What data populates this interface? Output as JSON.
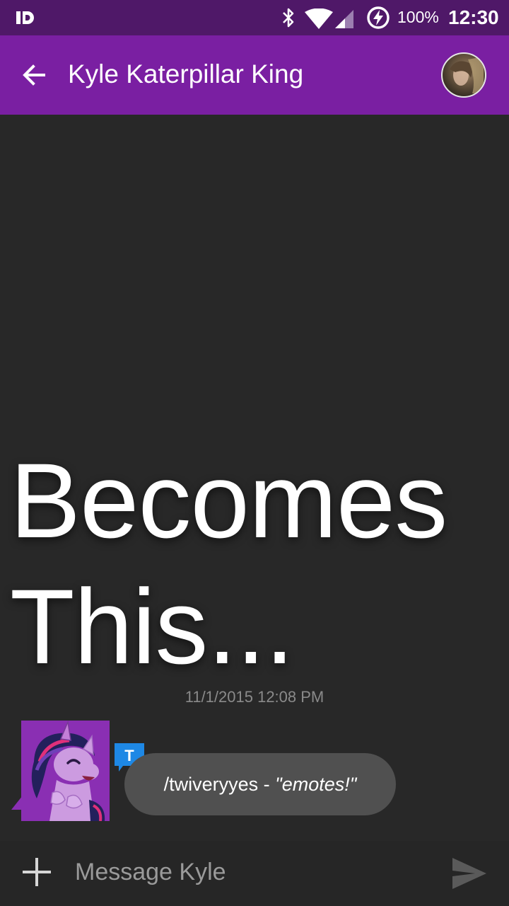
{
  "status_bar": {
    "left_icon": "id-app-icon",
    "icons": [
      "bluetooth-icon",
      "wifi-icon",
      "cell-signal-icon",
      "battery-charging-icon"
    ],
    "battery_percent": "100%",
    "time": "12:30"
  },
  "app_bar": {
    "back_icon": "arrow-back-icon",
    "title": "Kyle Katerpillar King",
    "avatar_icon": "contact-avatar",
    "background_color": "#7a1fa2"
  },
  "overlay_caption": {
    "line1": "Becomes",
    "line2": "This..."
  },
  "conversation": {
    "timestamp": "11/1/2015 12:08 PM",
    "messages": [
      {
        "sender_avatar": "twilight-sparkle-avatar",
        "service_badge_icon": "text-message-badge-icon",
        "service_badge_letter": "T",
        "text_plain": "/twiveryyes - ",
        "text_italic": "\"emotes!\""
      }
    ]
  },
  "compose": {
    "attach_icon": "plus-icon",
    "placeholder": "Message Kyle",
    "send_icon": "send-icon"
  },
  "colors": {
    "status_bar": "#4f1868",
    "app_bar": "#7a1fa2",
    "background": "#282828",
    "bubble": "#505050",
    "badge": "#1e88e5"
  }
}
